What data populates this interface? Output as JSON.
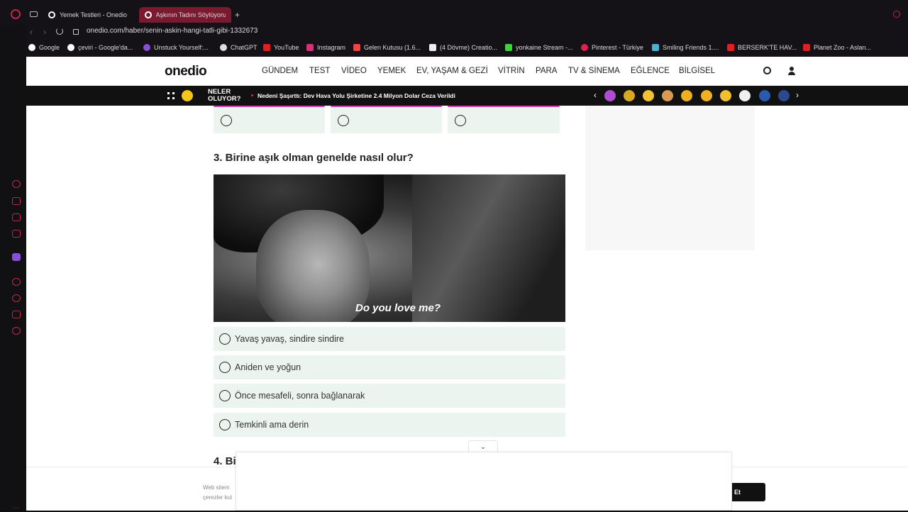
{
  "browser": {
    "tabs": [
      {
        "label": "Yemek Testleri - Onedio"
      },
      {
        "label": "Aşkının Tadını Söylüyoruz!"
      }
    ],
    "new_tab": "+",
    "url": "onedio.com/haber/senin-askin-hangi-tatli-gibi-1332673",
    "bookmarks": [
      {
        "label": "Google"
      },
      {
        "label": "çeviri - Google'da..."
      },
      {
        "label": "Unstuck Yourself:..."
      },
      {
        "label": "ChatGPT"
      },
      {
        "label": "YouTube"
      },
      {
        "label": "Instagram"
      },
      {
        "label": "Gelen Kutusu (1.6..."
      },
      {
        "label": "(4 Dövme) Creatio..."
      },
      {
        "label": "yonkaine Stream -..."
      },
      {
        "label": "Pinterest - Türkiye"
      },
      {
        "label": "Smiling Friends 1...."
      },
      {
        "label": "BERSERK'TE HAV..."
      },
      {
        "label": "Planet Zoo - Aslan..."
      }
    ]
  },
  "site": {
    "logo": "onedio",
    "nav": [
      "GÜNDEM",
      "TEST",
      "VİDEO",
      "YEMEK",
      "EV, YAŞAM & GEZİ",
      "VİTRİN",
      "PARA",
      "TV & SİNEMA",
      "EĞLENCE",
      "BİLGİSEL"
    ],
    "ticker_title": "NELER OLUYOR?",
    "ticker_text": "Nedeni Şaşırttı: Dev Hava Yolu Şirketine 2.4 Milyon Dolar Ceza Verildi"
  },
  "quiz": {
    "q3_title": "3. Birine aşık olman genelde nasıl olur?",
    "image_caption": "Do you love me?",
    "answers": [
      "Yavaş yavaş, sindire sindire",
      "Aniden ve yoğun",
      "Önce mesafeli, sonra bağlanarak",
      "Temkinli ama derin"
    ],
    "q4_title_partial": "4. Bi"
  },
  "cookie": {
    "line1": "Web sitem",
    "line2": "çerezler kul",
    "button": "Et"
  },
  "colors": {
    "accent": "#c0284a",
    "option_bg": "#ebf4ee",
    "ticker_bg": "#111111",
    "page_bg": "#ffffff"
  }
}
